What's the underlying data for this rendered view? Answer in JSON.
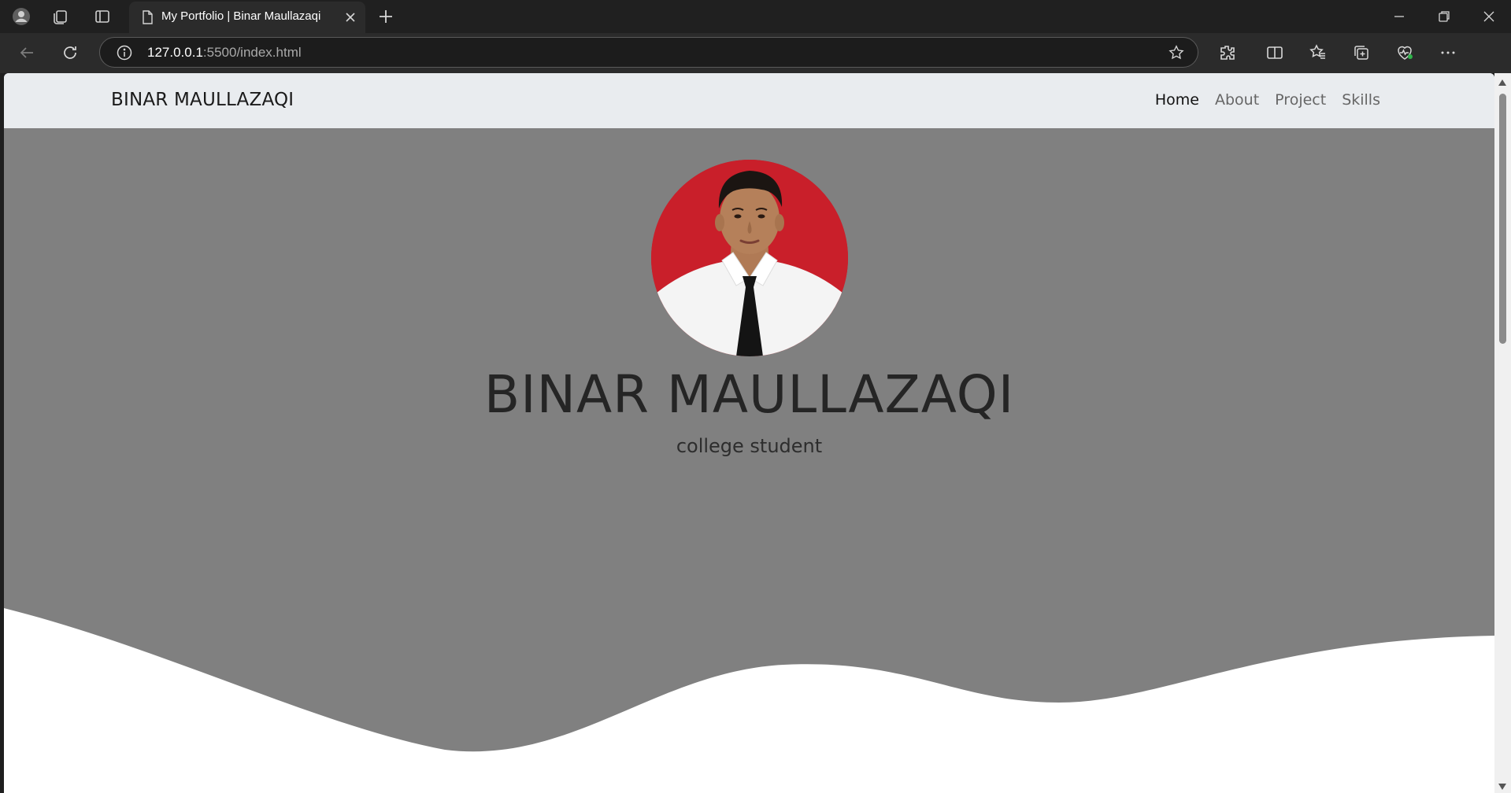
{
  "browser": {
    "tab": {
      "title": "My Portfolio | Binar Maullazaqi"
    },
    "address": {
      "host": "127.0.0.1",
      "rest": ":5500/index.html"
    },
    "colors": {
      "frame": "#202020",
      "toolbar": "#2b2b2b",
      "copilot": "#1aa0ff"
    },
    "toolbar_icons": [
      "back-icon",
      "refresh-icon",
      "info-icon",
      "star-icon",
      "extensions-icon",
      "split-screen-icon",
      "favorites-icon",
      "collections-icon",
      "browser-essentials-icon",
      "more-icon",
      "copilot-icon"
    ]
  },
  "site": {
    "navbar": {
      "brand": "BINAR MAULLAZAQI",
      "links": [
        {
          "label": "Home",
          "active": true
        },
        {
          "label": "About",
          "active": false
        },
        {
          "label": "Project",
          "active": false
        },
        {
          "label": "Skills",
          "active": false
        }
      ]
    },
    "hero": {
      "name": "BINAR MAULLAZAQI",
      "subtitle": "college student",
      "colors": {
        "background": "#808080",
        "wave": "#ffffff",
        "avatar_bg": "#c91f2a"
      }
    }
  }
}
